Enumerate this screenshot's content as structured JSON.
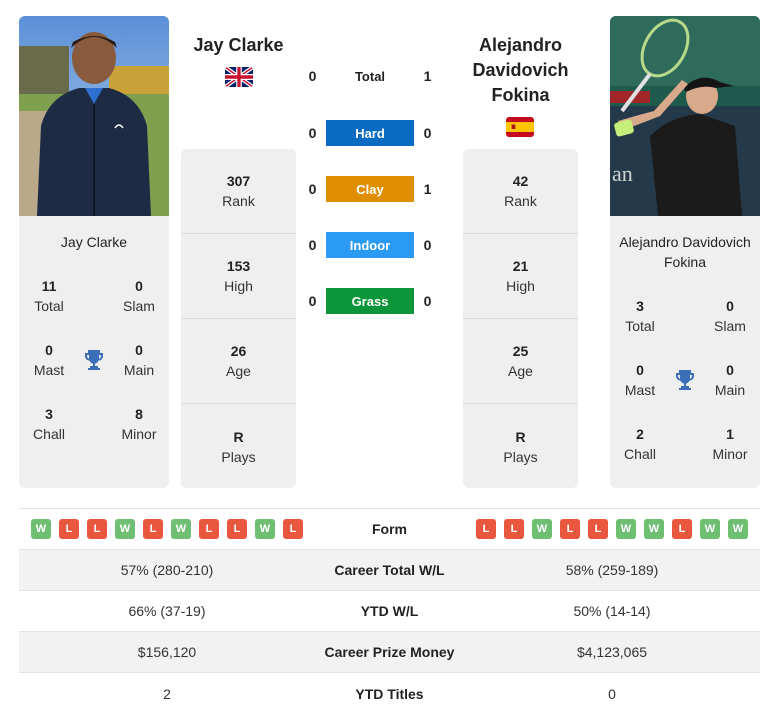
{
  "colors": {
    "hard": "#0a6bc2",
    "clay": "#df8e00",
    "indoor": "#2a9af5",
    "grass": "#0c963a",
    "win": "#6fbf73",
    "loss": "#e9573f",
    "trophy": "#3a6fb8"
  },
  "player_left": {
    "name": "Jay Clarke",
    "flag": "uk-flag",
    "stats": [
      {
        "value": "307",
        "label": "Rank"
      },
      {
        "value": "153",
        "label": "High"
      },
      {
        "value": "26",
        "label": "Age"
      },
      {
        "value": "R",
        "label": "Plays"
      }
    ],
    "titles": {
      "total": {
        "value": "11",
        "label": "Total"
      },
      "slam": {
        "value": "0",
        "label": "Slam"
      },
      "mast": {
        "value": "0",
        "label": "Mast"
      },
      "main": {
        "value": "0",
        "label": "Main"
      },
      "chall": {
        "value": "3",
        "label": "Chall"
      },
      "minor": {
        "value": "8",
        "label": "Minor"
      }
    },
    "form": [
      "W",
      "L",
      "L",
      "W",
      "L",
      "W",
      "L",
      "L",
      "W",
      "L"
    ]
  },
  "player_right": {
    "name": "Alejandro Davidovich Fokina",
    "flag": "spain-flag",
    "stats": [
      {
        "value": "42",
        "label": "Rank"
      },
      {
        "value": "21",
        "label": "High"
      },
      {
        "value": "25",
        "label": "Age"
      },
      {
        "value": "R",
        "label": "Plays"
      }
    ],
    "titles": {
      "total": {
        "value": "3",
        "label": "Total"
      },
      "slam": {
        "value": "0",
        "label": "Slam"
      },
      "mast": {
        "value": "0",
        "label": "Mast"
      },
      "main": {
        "value": "0",
        "label": "Main"
      },
      "chall": {
        "value": "2",
        "label": "Chall"
      },
      "minor": {
        "value": "1",
        "label": "Minor"
      }
    },
    "form": [
      "L",
      "L",
      "W",
      "L",
      "L",
      "W",
      "W",
      "L",
      "W",
      "W"
    ]
  },
  "h2h": [
    {
      "label": "Total",
      "left": "0",
      "right": "1",
      "key": "total"
    },
    {
      "label": "Hard",
      "left": "0",
      "right": "0",
      "key": "hard"
    },
    {
      "label": "Clay",
      "left": "0",
      "right": "1",
      "key": "clay"
    },
    {
      "label": "Indoor",
      "left": "0",
      "right": "0",
      "key": "indoor"
    },
    {
      "label": "Grass",
      "left": "0",
      "right": "0",
      "key": "grass"
    }
  ],
  "comparison": {
    "form_label": "Form",
    "rows": [
      {
        "label": "Career Total W/L",
        "left": "57% (280-210)",
        "right": "58% (259-189)"
      },
      {
        "label": "YTD W/L",
        "left": "66% (37-19)",
        "right": "50% (14-14)"
      },
      {
        "label": "Career Prize Money",
        "left": "$156,120",
        "right": "$4,123,065"
      },
      {
        "label": "YTD Titles",
        "left": "2",
        "right": "0"
      }
    ]
  }
}
